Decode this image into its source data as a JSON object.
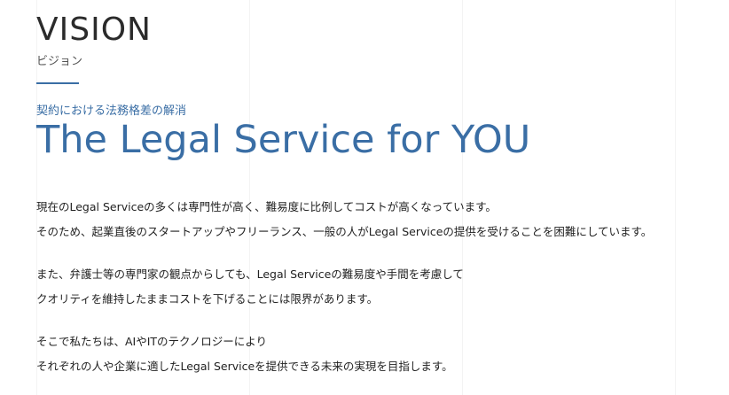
{
  "section": {
    "heading": "VISION",
    "subheading": "ビジョン",
    "tagline": "契約における法務格差の解消",
    "headline": "The Legal Service for YOU",
    "paragraphs": [
      {
        "lines": [
          "現在のLegal Serviceの多くは専門性が高く、難易度に比例してコストが高くなっています。",
          "そのため、起業直後のスタートアップやフリーランス、一般の人がLegal Serviceの提供を受けることを困難にしています。"
        ]
      },
      {
        "lines": [
          "また、弁護士等の専門家の観点からしても、Legal Serviceの難易度や手間を考慮して",
          "クオリティを維持したままコストを下げることには限界があります。"
        ]
      },
      {
        "lines": [
          "そこで私たちは、AIやITのテクノロジーにより",
          "それぞれの人や企業に適したLegal Serviceを提供できる未来の実現を目指します。"
        ]
      }
    ]
  },
  "colors": {
    "accent": "#3a6ea5",
    "heading": "#2b2b2b",
    "body_text": "#222222",
    "background": "#ffffff"
  }
}
